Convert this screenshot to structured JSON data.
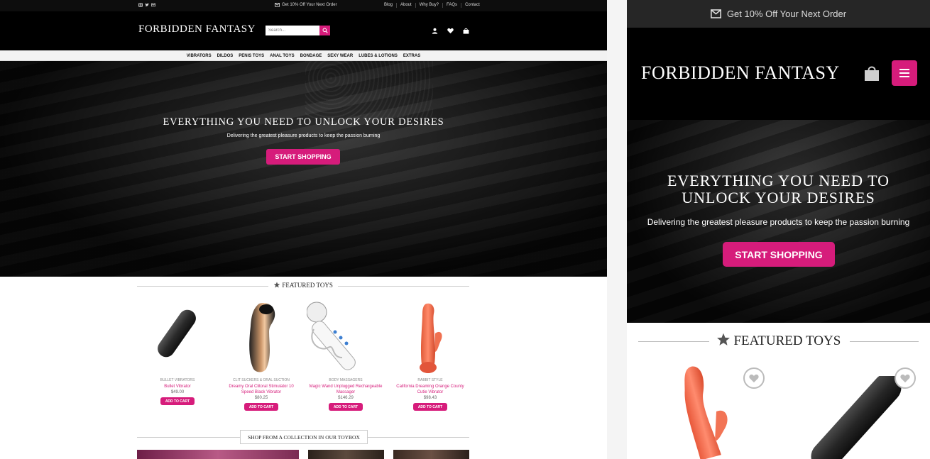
{
  "desktop": {
    "topbar": {
      "promo": "Get 10% Off Your Next Order",
      "links": [
        "Blog",
        "About",
        "Why Buy?",
        "FAQs",
        "Contact"
      ]
    },
    "logo": "FORBIDDEN FANTASY",
    "search": {
      "placeholder": "Search..."
    },
    "categories": [
      "Vibrators",
      "Dildos",
      "Penis Toys",
      "Anal Toys",
      "Bondage",
      "Sexy Wear",
      "Lubes & Lotions",
      "Extras"
    ],
    "hero": {
      "title": "EVERYTHING YOU NEED TO UNLOCK YOUR DESIRES",
      "subtitle": "Delivering the greatest pleasure products to keep the passion burning",
      "cta": "START SHOPPING"
    },
    "featured_title": "FEATURED TOYS",
    "products": [
      {
        "category": "BULLET VIBRATORS",
        "name": "Bullet Vibrator",
        "price": "$49.00",
        "button": "ADD TO CART"
      },
      {
        "category": "CLIT SUCKERS & ORAL SUCTION",
        "name": "Dreamy Oral Clitoral Stimulator 10 Speed Black Vibrator",
        "price": "$80.25",
        "button": "ADD TO CART"
      },
      {
        "category": "BODY MASSAGERS",
        "name": "Magic Wand Unplugged Rechargeable Massager",
        "price": "$146.29",
        "button": "ADD TO CART"
      },
      {
        "category": "RABBIT STYLE",
        "name": "California Dreaming Orange County Cutie Vibrator",
        "price": "$98.43",
        "button": "ADD TO CART"
      }
    ],
    "collection_title": "SHOP FROM A COLLECTION IN OUR TOYBOX"
  },
  "mobile": {
    "promo": "Get 10% Off Your Next Order",
    "logo": "FORBIDDEN FANTASY",
    "hero": {
      "title_line1": "EVERYTHING YOU NEED TO",
      "title_line2": "UNLOCK YOUR DESIRES",
      "subtitle": "Delivering the greatest pleasure products to keep the passion burning",
      "cta": "START SHOPPING"
    },
    "featured_title": "FEATURED TOYS"
  },
  "colors": {
    "accent": "#d61c7b",
    "header": "#000000",
    "topbar": "#0d0d0d",
    "mobile_topbar": "#262626"
  }
}
